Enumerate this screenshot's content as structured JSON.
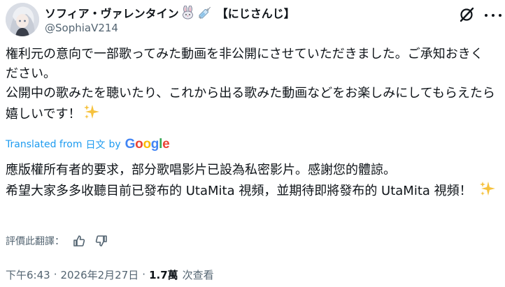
{
  "post": {
    "author": {
      "display_name": "ソフィア・ヴァレンタイン",
      "name_emojis": [
        "rabbit-emoji",
        "syringe-emoji"
      ],
      "group_tag": "【にじさんじ】",
      "handle": "@SophiaV214"
    },
    "original_text": [
      "権利元の意向で一部歌ってみた動画を非公開にさせていただきました。ご承知おきください。",
      "公開中の歌みたを聴いたり、これから出る歌みた動画などをお楽しみにしてもらえたら嬉しいです！"
    ],
    "translation": {
      "label": "Translated from",
      "language": "日文",
      "by": "by",
      "provider": "Google",
      "text": [
        "應版權所有者的要求，部分歌唱影片已設為私密影片。感謝您的體諒。",
        "希望大家多多收聽目前已發布的 UtaMita 視頻，並期待即將發布的 UtaMita 視頻！"
      ]
    },
    "rate_prompt": "評價此翻譯：",
    "meta": {
      "time": "下午6:43",
      "date": "2026年2月27日",
      "views_count": "1.7萬",
      "views_label": "次查看"
    }
  },
  "colors": {
    "text": "#0f1419",
    "secondary": "#536471",
    "link": "#1d9bf0",
    "google": [
      "#4285F4",
      "#EA4335",
      "#FBBC05",
      "#4285F4",
      "#34A853",
      "#EA4335"
    ]
  },
  "icons": [
    "grok-icon",
    "more-icon",
    "sparkle-icon",
    "thumbs-up-icon",
    "thumbs-down-icon"
  ]
}
